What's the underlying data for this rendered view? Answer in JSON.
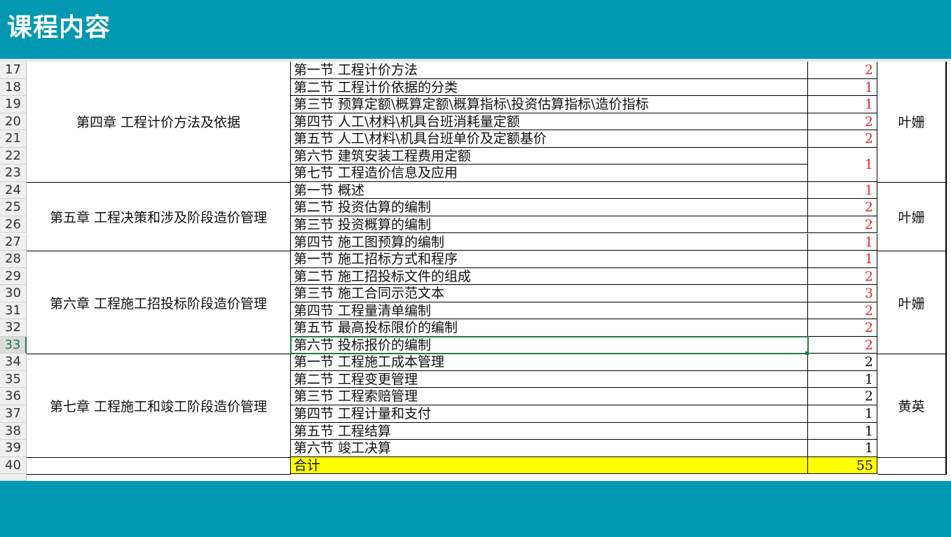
{
  "header": {
    "title": "课程内容"
  },
  "rows": [
    {
      "num": "17",
      "section": "第一节  工程计价方法",
      "hours": "2"
    },
    {
      "num": "18",
      "section": "第二节  工程计价依据的分类",
      "hours": "1"
    },
    {
      "num": "19",
      "section": "第三节  预算定额\\概算定额\\概算指标\\投资估算指标\\造价指标",
      "hours": "1"
    },
    {
      "num": "20",
      "section": "第四节  人工\\材料\\机具台班消耗量定额",
      "hours": "2"
    },
    {
      "num": "21",
      "section": "第五节  人工\\材料\\机具台班单价及定额基价",
      "hours": "2"
    },
    {
      "num": "22",
      "section": "第六节  建筑安装工程费用定额",
      "hours": ""
    },
    {
      "num": "23",
      "section": "第七节  工程造价信息及应用",
      "hours": ""
    },
    {
      "num": "24",
      "section": "第一节  概述",
      "hours": "1"
    },
    {
      "num": "25",
      "section": "第二节  投资估算的编制",
      "hours": "2"
    },
    {
      "num": "26",
      "section": "第三节  投资概算的编制",
      "hours": "2"
    },
    {
      "num": "27",
      "section": "第四节  施工图预算的编制",
      "hours": "1"
    },
    {
      "num": "28",
      "section": "第一节  施工招标方式和程序",
      "hours": "1"
    },
    {
      "num": "29",
      "section": "第二节  施工招投标文件的组成",
      "hours": "2"
    },
    {
      "num": "30",
      "section": "第三节  施工合同示范文本",
      "hours": "3"
    },
    {
      "num": "31",
      "section": "第四节  工程量清单编制",
      "hours": "2"
    },
    {
      "num": "32",
      "section": "第五节  最高投标限价的编制",
      "hours": "2"
    },
    {
      "num": "33",
      "section": "第六节  投标报价的编制",
      "hours": "2"
    },
    {
      "num": "34",
      "section": "第一节  工程施工成本管理",
      "hours": "2"
    },
    {
      "num": "35",
      "section": "第二节  工程变更管理",
      "hours": "1"
    },
    {
      "num": "36",
      "section": "第三节  工程索赔管理",
      "hours": "2"
    },
    {
      "num": "37",
      "section": "第四节  工程计量和支付",
      "hours": "1"
    },
    {
      "num": "38",
      "section": "第五节  工程结算",
      "hours": "1"
    },
    {
      "num": "39",
      "section": "第六节  竣工决算",
      "hours": "1"
    },
    {
      "num": "40",
      "section": "合计",
      "hours": "55"
    }
  ],
  "merged_hours": {
    "rows_22_23": "1"
  },
  "chapters": [
    {
      "title": "第四章  工程计价方法及依据",
      "teacher": "叶姗"
    },
    {
      "title": "第五章  工程决策和涉及阶段造价管理",
      "teacher": "叶姗"
    },
    {
      "title": "第六章  工程施工招投标阶段造价管理",
      "teacher": "叶姗"
    },
    {
      "title": "第七章  工程施工和竣工阶段造价管理",
      "teacher": "黄英"
    }
  ],
  "selected_row": "33",
  "colors": {
    "header_bg": "#0198b2",
    "red_text": "#e8292a",
    "total_bg": "#ffff00",
    "selection": "#1d7a45"
  }
}
